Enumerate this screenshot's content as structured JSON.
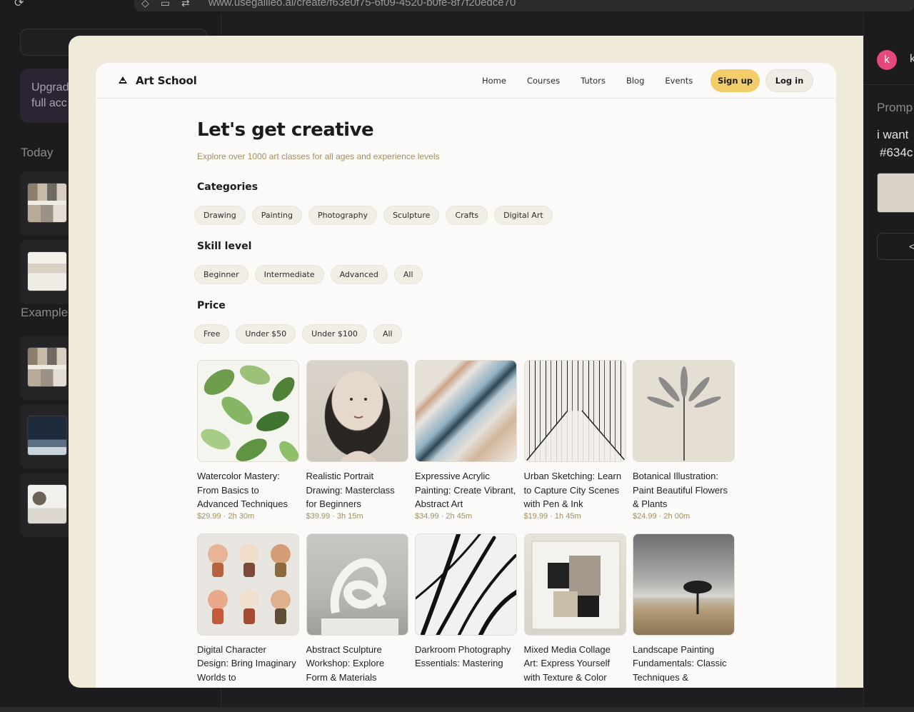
{
  "browser": {
    "url": "www.usegalileo.ai/create/f63e0f75-6f09-4520-b0fe-8f7f20edce70"
  },
  "left_sidebar": {
    "upgrade_line1": "Upgrad",
    "upgrade_line2": "full acc",
    "today_label": "Today",
    "examples_label": "Example"
  },
  "right_panel": {
    "avatar_letter": "k",
    "avatar_name": "k",
    "prompt_label": "Promp",
    "prompt_line1": "i want",
    "prompt_line2": "#634c",
    "code_icon": "</>"
  },
  "site": {
    "logo_text": "Art School",
    "nav": [
      "Home",
      "Courses",
      "Tutors",
      "Blog",
      "Events"
    ],
    "signup_label": "Sign up",
    "login_label": "Log in",
    "title": "Let's get creative",
    "subtitle": "Explore over 1000 art classes for all ages and experience levels",
    "sections": {
      "categories": {
        "title": "Categories",
        "chips": [
          "Drawing",
          "Painting",
          "Photography",
          "Sculpture",
          "Crafts",
          "Digital Art"
        ]
      },
      "skill": {
        "title": "Skill level",
        "chips": [
          "Beginner",
          "Intermediate",
          "Advanced",
          "All"
        ]
      },
      "price": {
        "title": "Price",
        "chips": [
          "Free",
          "Under $50",
          "Under $100",
          "All"
        ]
      }
    },
    "courses": [
      {
        "title": "Watercolor Mastery: From Basics to Advanced Techniques",
        "meta": "$29.99 · 2h 30m",
        "image": "watercolor"
      },
      {
        "title": "Realistic Portrait Drawing: Masterclass for Beginners",
        "meta": "$39.99 · 3h 15m",
        "image": "portrait"
      },
      {
        "title": "Expressive Acrylic Painting: Create Vibrant, Abstract Art",
        "meta": "$34.99 · 2h 45m",
        "image": "acrylic"
      },
      {
        "title": "Urban Sketching: Learn to Capture City Scenes with Pen & Ink",
        "meta": "$19.99 · 1h 45m",
        "image": "city"
      },
      {
        "title": "Botanical Illustration: Paint Beautiful Flowers & Plants",
        "meta": "$24.99 · 2h 00m",
        "image": "botanical"
      },
      {
        "title": "Digital Character Design: Bring Imaginary Worlds to",
        "meta": "",
        "image": "characters"
      },
      {
        "title": "Abstract Sculpture Workshop: Explore Form & Materials",
        "meta": "",
        "image": "sculpture"
      },
      {
        "title": "Darkroom Photography Essentials: Mastering",
        "meta": "",
        "image": "darkroom"
      },
      {
        "title": "Mixed Media Collage Art: Express Yourself with Texture & Color",
        "meta": "",
        "image": "collage"
      },
      {
        "title": "Landscape Painting Fundamentals: Classic Techniques &",
        "meta": "",
        "image": "landscape"
      }
    ]
  }
}
